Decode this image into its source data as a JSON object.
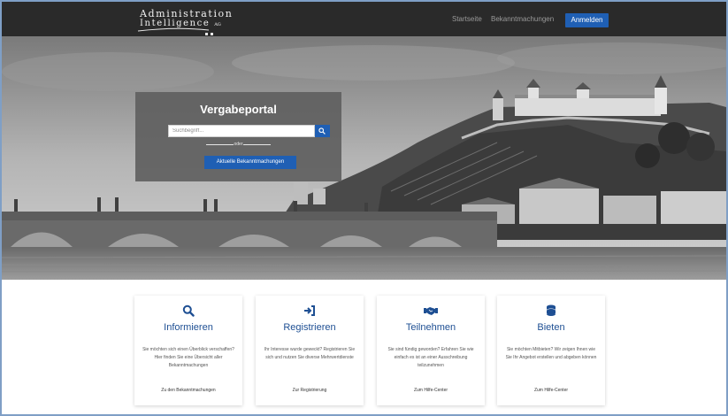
{
  "brand": {
    "line1": "Administration",
    "line2": "Intelligence",
    "suffix": "AG"
  },
  "nav": {
    "items": [
      "Startseite",
      "Bekanntmachungen"
    ],
    "login_label": "Anmelden"
  },
  "hero": {
    "title": "Vergabeportal",
    "search_placeholder": "Suchbegriff...",
    "divider_text": "oder",
    "cta_label": "Aktuelle Bekanntmachungen"
  },
  "cards": [
    {
      "icon": "search-icon",
      "title": "Informieren",
      "text": "Sie möchten sich einen Überblick verschaffen? Hier finden Sie eine Übersicht aller Bekanntmachungen",
      "link": "Zu den Bekanntmachungen"
    },
    {
      "icon": "sign-in-icon",
      "title": "Registrieren",
      "text": "Ihr Interesse wurde geweckt? Registrieren Sie sich und nutzen Sie diverse Mehrwertdienste",
      "link": "Zur Registrierung"
    },
    {
      "icon": "handshake-icon",
      "title": "Teilnehmen",
      "text": "Sie sind fündig geworden? Erfahren Sie wie einfach es ist an einer Ausschreibung teilzunehmen",
      "link": "Zum Hilfe-Center"
    },
    {
      "icon": "coins-icon",
      "title": "Bieten",
      "text": "Sie möchten Mitbieten? Wir zeigen Ihnen wie Sie Ihr Angebot erstellen und abgeben können",
      "link": "Zum Hilfe-Center"
    }
  ],
  "colors": {
    "topbar": "#2a2a2a",
    "accent": "#1f5fb4",
    "card_title": "#1e4f93"
  }
}
